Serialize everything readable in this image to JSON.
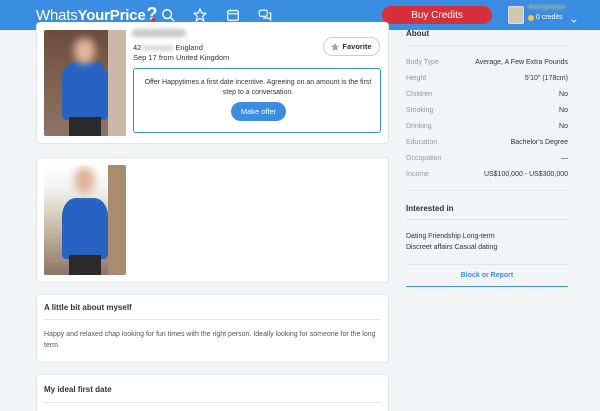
{
  "header": {
    "logo_part1": "Whats",
    "logo_part2": "YourPrice",
    "logo_mark": "?",
    "buy_credits_label": "Buy Credits",
    "username": "Anonymous",
    "credits_label": "0 credits",
    "nav_icons": [
      "search-icon",
      "star-icon",
      "calendar-icon",
      "chat-icon"
    ],
    "accent_color": "#3a8de0",
    "buy_color": "#d8303a"
  },
  "profile": {
    "location_prefix": "42",
    "location_suffix": "England",
    "online_status": "Sep 17 from United Kingdom",
    "favorite_label": "Favorite",
    "offer_text": "Offer Happytimes a first date incentive. Agreeing on an amount is the first step to a conversation.",
    "make_offer_label": "Make offer"
  },
  "about_myself": {
    "title": "A little bit about myself",
    "text": "Happy and relaxed chap looking for fun times with the right person. Ideally looking for someone for the long term."
  },
  "ideal_date": {
    "title": "My ideal first date"
  },
  "about": {
    "title": "About",
    "rows": [
      {
        "key": "Body Type",
        "value": "Average, A Few Extra Pounds"
      },
      {
        "key": "Height",
        "value": "5'10\" (178cm)"
      },
      {
        "key": "Children",
        "value": "No"
      },
      {
        "key": "Smoking",
        "value": "No"
      },
      {
        "key": "Drinking",
        "value": "No"
      },
      {
        "key": "Education",
        "value": "Bachelor's Degree"
      },
      {
        "key": "Occupation",
        "value": "—"
      },
      {
        "key": "Income",
        "value": "US$100,000 - US$300,000"
      }
    ]
  },
  "interested_in": {
    "title": "Interested in",
    "line1": "Dating  Friendship  Long-term",
    "line2": "Discreet affairs  Casual dating"
  },
  "block_report_label": "Block or Report"
}
